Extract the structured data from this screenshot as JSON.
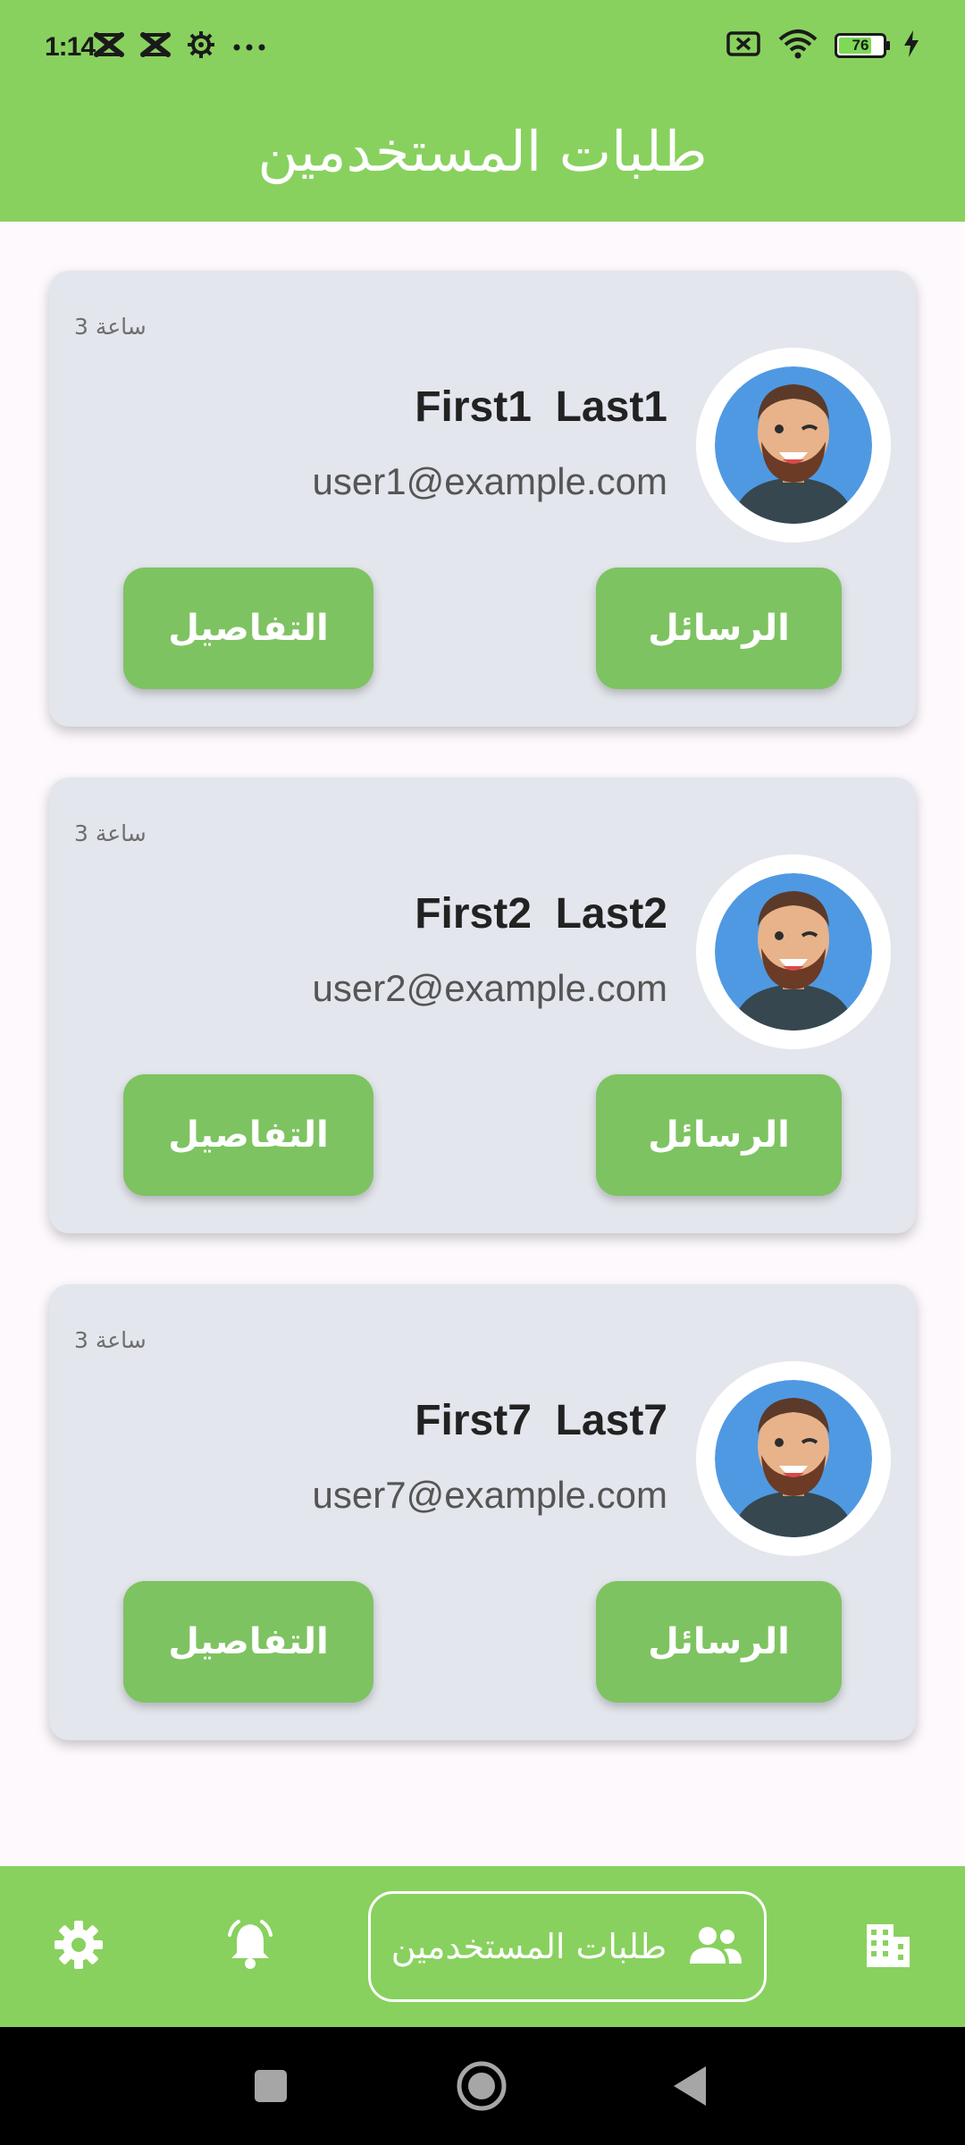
{
  "status_bar": {
    "time": "1:14",
    "battery_level": "76",
    "left_icons": [
      "x-notification-icon",
      "x-notification-icon",
      "settings-gear-icon",
      "more-dots-icon"
    ],
    "right_icons": [
      "no-sim-icon",
      "wifi-icon",
      "battery-icon",
      "charging-icon"
    ]
  },
  "app_bar": {
    "title": "طلبات المستخدمين"
  },
  "cards": [
    {
      "time_ago": "3 ساعة",
      "name": "First1  Last1",
      "email": "user1@example.com",
      "messages_label": "الرسائل",
      "details_label": "التفاصيل"
    },
    {
      "time_ago": "3 ساعة",
      "name": "First2  Last2",
      "email": "user2@example.com",
      "messages_label": "الرسائل",
      "details_label": "التفاصيل"
    },
    {
      "time_ago": "3 ساعة",
      "name": "First7  Last7",
      "email": "user7@example.com",
      "messages_label": "الرسائل",
      "details_label": "التفاصيل"
    }
  ],
  "bottom_nav": {
    "items": [
      {
        "icon": "gear-icon"
      },
      {
        "icon": "bell-icon"
      },
      {
        "icon": "people-icon",
        "label": "طلبات المستخدمين",
        "active": true
      },
      {
        "icon": "building-icon"
      }
    ]
  },
  "colors": {
    "primary": "#88d15e",
    "button": "#7ec361",
    "card": "#e3e6ec",
    "background": "#fdf9fd"
  }
}
